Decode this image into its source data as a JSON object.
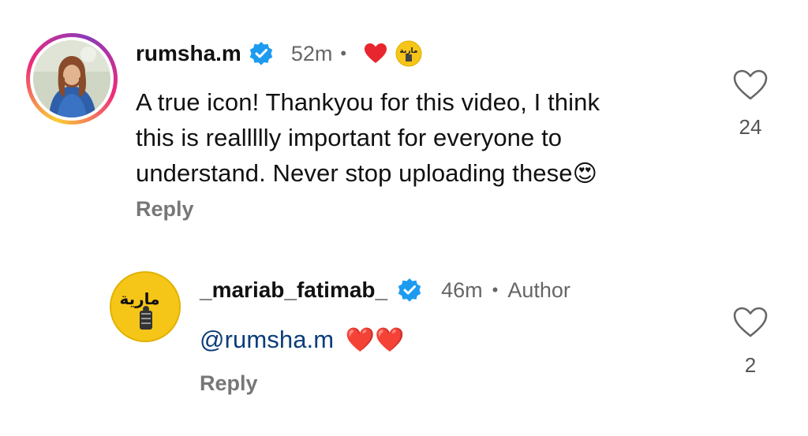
{
  "comment": {
    "username": "rumsha.m",
    "time": "52m",
    "text_line1": "A true icon! Thankyou for this video, I think",
    "text_line2": "this is reallllly important for everyone to",
    "text_line3": "understand. Never stop uploading these",
    "text_emoji": "😍",
    "reply_label": "Reply",
    "like_count": "24",
    "liked_by_author_heart": "❤️"
  },
  "reply": {
    "username": "_mariab_fatimab_",
    "time": "46m",
    "author_label": "Author",
    "mention": "@rumsha.m",
    "hearts": "❤️❤️",
    "reply_label": "Reply",
    "like_count": "2",
    "logo_text": "مارية"
  },
  "separator": "•",
  "colors": {
    "verified_blue": "#1d9bf0",
    "heart_red": "#e8262f",
    "logo_yellow": "#f5c518",
    "mention_blue": "#0a3d7a"
  }
}
